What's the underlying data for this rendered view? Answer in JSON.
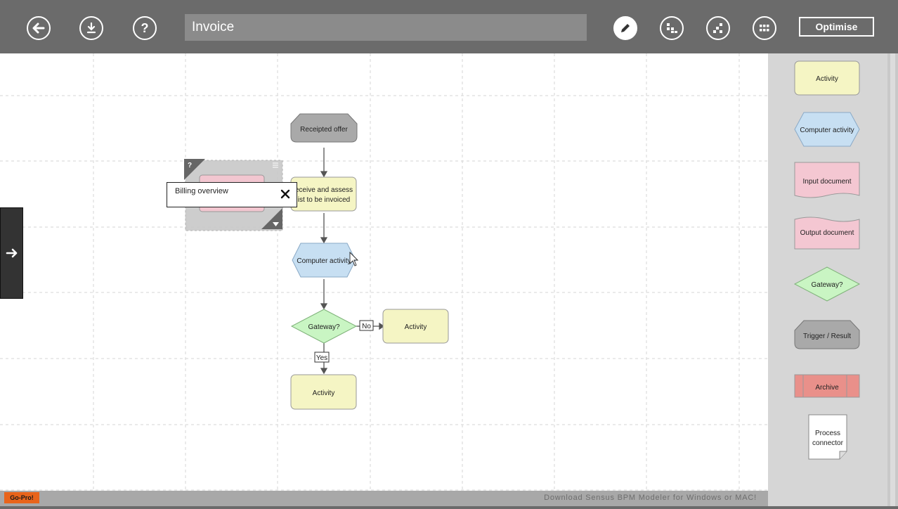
{
  "toolbar": {
    "title": "Invoice",
    "optimise_label": "Optimise"
  },
  "diagram": {
    "start_event": "Receipted offer",
    "task_assess": "Receive and assess list to be invoiced",
    "task_assess_line1": "eceive and assess",
    "task_assess_line2": "ist to be invoiced",
    "computer_activity": "Computer activity",
    "gateway": "Gateway?",
    "label_no": "No",
    "label_yes": "Yes",
    "activity_right": "Activity",
    "activity_bottom": "Activity"
  },
  "tooltip": {
    "text": "Billing overview"
  },
  "palette": {
    "items": [
      {
        "label": "Activity"
      },
      {
        "label": "Computer activity"
      },
      {
        "label": "Input document"
      },
      {
        "label": "Output document"
      },
      {
        "label": "Gateway?"
      },
      {
        "label": "Trigger / Result"
      },
      {
        "label": "Archive"
      },
      {
        "label": "Process connector",
        "line1": "Process",
        "line2": "connector"
      }
    ]
  },
  "footer": {
    "gopro_label": "Go-Pro!",
    "download_text": "Download Sensus BPM Modeler for Windows or MAC!"
  },
  "colors": {
    "activity": "#f5f5c4",
    "computer_activity": "#c7dff2",
    "document": "#f4c7d2",
    "gateway": "#c9f5c3",
    "trigger": "#a9a9a9",
    "archive": "#e9908a",
    "toolbar": "#6b6b6b"
  }
}
